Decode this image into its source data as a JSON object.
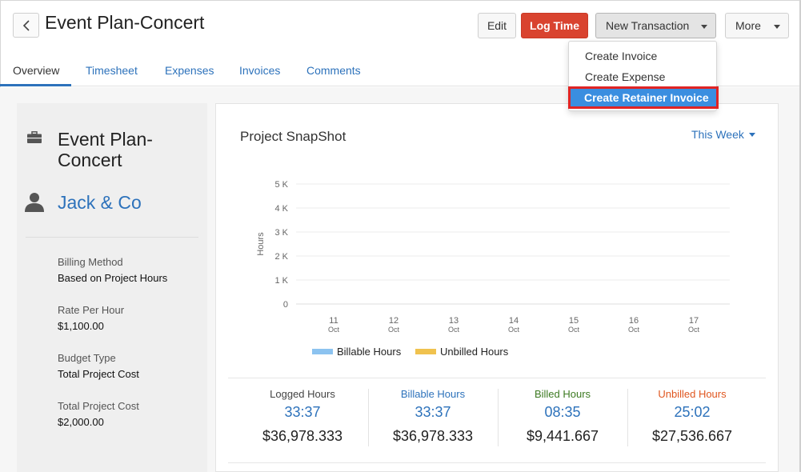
{
  "header": {
    "title": "Event Plan-Concert",
    "buttons": {
      "edit": "Edit",
      "log_time": "Log Time",
      "new_transaction": "New Transaction",
      "more": "More"
    }
  },
  "dropdown": {
    "items": [
      "Create Invoice",
      "Create Expense",
      "Create Retainer Invoice"
    ],
    "highlighted": "Create Retainer Invoice"
  },
  "tabs": [
    {
      "label": "Overview",
      "active": true
    },
    {
      "label": "Timesheet",
      "active": false
    },
    {
      "label": "Expenses",
      "active": false
    },
    {
      "label": "Invoices",
      "active": false
    },
    {
      "label": "Comments",
      "active": false
    }
  ],
  "project": {
    "name": "Event Plan-Concert",
    "client": "Jack & Co",
    "fields": [
      {
        "label": "Billing Method",
        "value": "Based on Project Hours"
      },
      {
        "label": "Rate Per Hour",
        "value": "$1,100.00"
      },
      {
        "label": "Budget Type",
        "value": "Total Project Cost"
      },
      {
        "label": "Total Project Cost",
        "value": "$2,000.00"
      }
    ]
  },
  "snapshot": {
    "title": "Project SnapShot",
    "period": "This Week"
  },
  "chart_data": {
    "type": "bar",
    "categories": [
      "11",
      "12",
      "13",
      "14",
      "15",
      "16",
      "17"
    ],
    "category_sublabel": "Oct",
    "ylabel": "Hours",
    "ytick_labels": [
      "0",
      "1 K",
      "2 K",
      "3 K",
      "4 K",
      "5 K"
    ],
    "ylim": [
      0,
      5000
    ],
    "grid": true,
    "legend_position": "bottom",
    "series": [
      {
        "name": "Billable Hours",
        "color": "#8cc3f0",
        "values": [
          0,
          0,
          0,
          0,
          0,
          0,
          0
        ]
      },
      {
        "name": "Unbilled Hours",
        "color": "#f0c24e",
        "values": [
          0,
          0,
          0,
          0,
          0,
          0,
          0
        ]
      }
    ]
  },
  "stats": [
    {
      "label": "Logged Hours",
      "label_color": "#444444",
      "hours": "33:37",
      "amount": "$36,978.333"
    },
    {
      "label": "Billable Hours",
      "label_color": "#2d72bb",
      "hours": "33:37",
      "amount": "$36,978.333"
    },
    {
      "label": "Billed Hours",
      "label_color": "#3d7a22",
      "hours": "08:35",
      "amount": "$9,441.667"
    },
    {
      "label": "Unbilled Hours",
      "label_color": "#e0561f",
      "hours": "25:02",
      "amount": "$27,536.667"
    }
  ],
  "icons": {
    "back": "chevron-left-icon",
    "project": "briefcase-icon",
    "client": "user-icon"
  }
}
